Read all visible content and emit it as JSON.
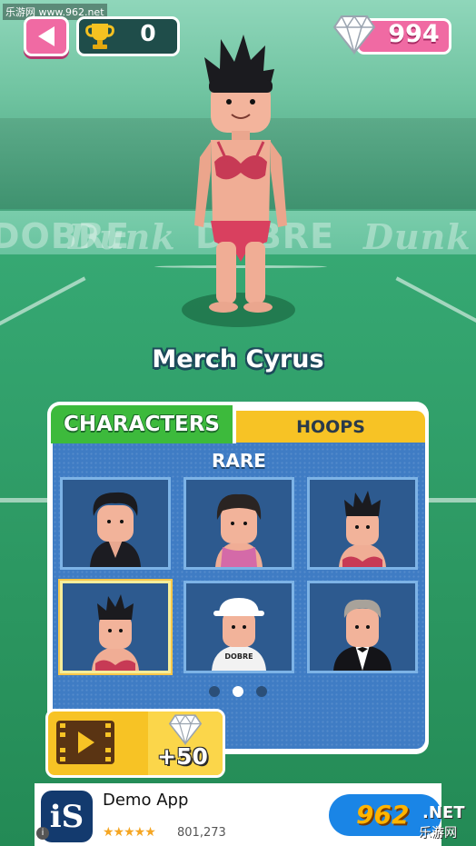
{
  "watermark": {
    "top_text": "乐游网 www.962.net",
    "logo_number": "962",
    "logo_suffix": ".NET",
    "logo_site": "乐游网"
  },
  "hud": {
    "trophy_count": "0",
    "gem_count": "994"
  },
  "arena": {
    "banner_words": [
      "DOBRE",
      "Dunk",
      "DOBRE",
      "Dunk"
    ]
  },
  "character": {
    "name": "Merch Cyrus"
  },
  "tabs": [
    {
      "label": "CHARACTERS",
      "active": true
    },
    {
      "label": "HOOPS",
      "active": false
    }
  ],
  "rarity_label": "RARE",
  "cards": [
    {
      "outfit": "black-shirt",
      "selected": false
    },
    {
      "outfit": "pink-tank",
      "selected": false
    },
    {
      "outfit": "red-bikini",
      "selected": false
    },
    {
      "outfit": "red-bikini",
      "selected": true
    },
    {
      "outfit": "dobre-cap",
      "shirt_text": "DOBRE",
      "selected": false
    },
    {
      "outfit": "tuxedo",
      "selected": false
    }
  ],
  "pager": {
    "pages": 3,
    "current": 2
  },
  "video_reward": {
    "label": "+50"
  },
  "ad": {
    "title": "Demo App",
    "stars": "★★★★★",
    "rating_count": "801,273",
    "icon_text": "iS"
  },
  "colors": {
    "pink": "#f06aa3",
    "green_tab": "#3dba3c",
    "yellow_tab": "#f7c325",
    "panel_blue": "#3f7cc4"
  }
}
